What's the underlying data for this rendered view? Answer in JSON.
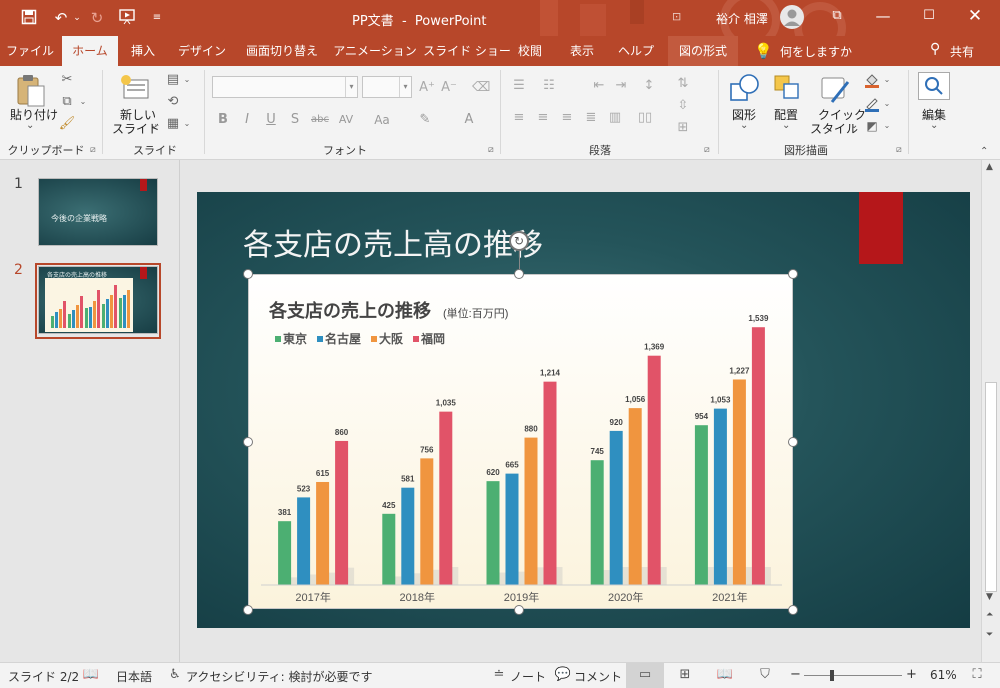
{
  "window": {
    "doc_name": "PP文書",
    "separator": "-",
    "app_name": "PowerPoint",
    "user_name": "裕介 相澤"
  },
  "tabs": [
    {
      "label": "ファイル",
      "active": false
    },
    {
      "label": "ホーム",
      "active": true
    },
    {
      "label": "挿入",
      "active": false
    },
    {
      "label": "デザイン",
      "active": false
    },
    {
      "label": "画面切り替え",
      "active": false
    },
    {
      "label": "アニメーション",
      "active": false
    },
    {
      "label": "スライド ショー",
      "active": false
    },
    {
      "label": "校閲",
      "active": false
    },
    {
      "label": "表示",
      "active": false
    },
    {
      "label": "ヘルプ",
      "active": false
    },
    {
      "label": "図の形式",
      "active": false
    }
  ],
  "tellme": "何をしますか",
  "share": "共有",
  "ribbon": {
    "clipboard": {
      "paste": "貼り付け",
      "paste_arrow": "⌄",
      "group": "クリップボード"
    },
    "slides": {
      "new_slide_1": "新しい",
      "new_slide_2": "スライド",
      "new_slide_arrow": "⌄",
      "group": "スライド"
    },
    "font": {
      "group": "フォント"
    },
    "paragraph": {
      "group": "段落"
    },
    "drawing": {
      "shape": "図形",
      "shape_arrow": "⌄",
      "arrange": "配置",
      "arrange_arrow": "⌄",
      "quick_style_1": "クイック",
      "quick_style_2": "スタイル",
      "quick_style_arrow": "⌄",
      "group": "図形描画"
    },
    "editing": {
      "label": "編集",
      "arrow": "⌄"
    }
  },
  "thumbnails": [
    {
      "number": "1",
      "title": "今後の企業戦略"
    },
    {
      "number": "2",
      "title": "各支店の売上高の推移"
    }
  ],
  "slide": {
    "title": "各支店の売上高の推移"
  },
  "chart_data": {
    "type": "bar",
    "title": "各支店の売上の推移",
    "subtitle": "(単位:百万円)",
    "categories": [
      "2017年",
      "2018年",
      "2019年",
      "2020年",
      "2021年"
    ],
    "series": [
      {
        "name": "東京",
        "color": "#4caf72",
        "values": [
          381,
          425,
          620,
          745,
          954
        ]
      },
      {
        "name": "名古屋",
        "color": "#2f8fc0",
        "values": [
          523,
          581,
          665,
          920,
          1053
        ]
      },
      {
        "name": "大阪",
        "color": "#f0953f",
        "values": [
          615,
          756,
          880,
          1056,
          1227
        ]
      },
      {
        "name": "福岡",
        "color": "#e15368",
        "values": [
          860,
          1035,
          1214,
          1369,
          1539
        ]
      }
    ],
    "data_labels": [
      [
        "381",
        "425",
        "620",
        "745",
        "954"
      ],
      [
        "523",
        "581",
        "665",
        "920",
        "1,053"
      ],
      [
        "615",
        "756",
        "880",
        "1,056",
        "1,227"
      ],
      [
        "860",
        "1,035",
        "1,214",
        "1,369",
        "1,539"
      ]
    ],
    "ylim": [
      0,
      1600
    ],
    "legend": "top-left",
    "grid": false
  },
  "status": {
    "slide": "スライド 2/2",
    "language": "日本語",
    "accessibility": "アクセシビリティ: 検討が必要です",
    "notes": "ノート",
    "comments": "コメント",
    "zoom": "61%",
    "zoom_minus": "−",
    "zoom_plus": "+"
  },
  "colors": {
    "accent": "#b7472a",
    "slide_bg": "#1f4f55",
    "slide_tag": "#b5171a"
  }
}
